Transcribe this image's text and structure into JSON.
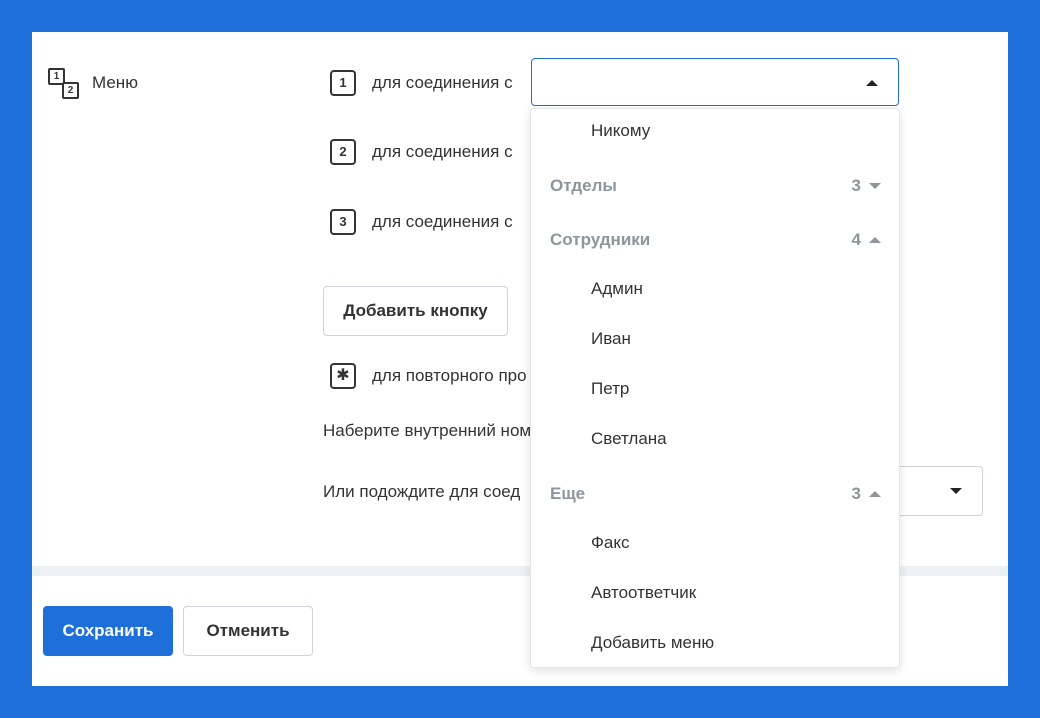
{
  "menu": {
    "label": "Меню"
  },
  "rows": [
    {
      "key": "1",
      "text": "для соединения с"
    },
    {
      "key": "2",
      "text": "для соединения с"
    },
    {
      "key": "3",
      "text": "для соединения с"
    }
  ],
  "add_button_label": "Добавить кнопку",
  "repeat_row": {
    "key": "✱",
    "text": "для повторного про"
  },
  "extension_text": "Наберите внутренний ном",
  "wait_text": "Или подождите для соед",
  "footer": {
    "save_label": "Сохранить",
    "cancel_label": "Отменить"
  },
  "dropdown": {
    "nobody": "Никому",
    "groups": {
      "departments": {
        "label": "Отделы",
        "count": "3"
      },
      "employees": {
        "label": "Сотрудники",
        "count": "4"
      },
      "more": {
        "label": "Еще",
        "count": "3"
      }
    },
    "employees": [
      "Админ",
      "Иван",
      "Петр",
      "Светлана"
    ],
    "more_items": [
      "Факс",
      "Автоответчик",
      "Добавить меню"
    ]
  },
  "colors": {
    "accent": "#1e6fd9",
    "group_text": "#8d959d"
  },
  "icons": {
    "menu": "keypad-1-2-icon",
    "select_open": "caret-up-icon",
    "select_closed": "caret-down-icon",
    "group_collapsed": "caret-down-icon",
    "group_expanded": "caret-up-icon"
  }
}
